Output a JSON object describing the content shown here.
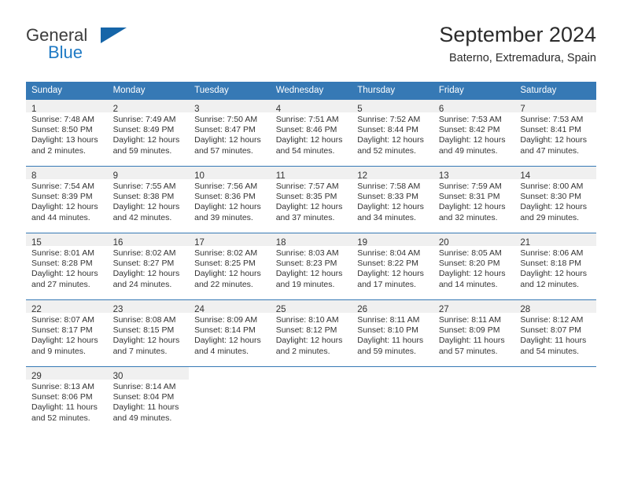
{
  "brand": {
    "name_part1": "General",
    "name_part2": "Blue",
    "logo_icon": "triangle-flag-icon"
  },
  "header": {
    "title": "September 2024",
    "subtitle": "Baterno, Extremadura, Spain"
  },
  "colors": {
    "header_blue": "#3679b5",
    "brand_blue": "#1f7ac4",
    "daynum_bg": "#f0f0f0",
    "text": "#333333"
  },
  "weekday_headers": [
    "Sunday",
    "Monday",
    "Tuesday",
    "Wednesday",
    "Thursday",
    "Friday",
    "Saturday"
  ],
  "weeks": [
    [
      {
        "day": "1",
        "sunrise": "Sunrise: 7:48 AM",
        "sunset": "Sunset: 8:50 PM",
        "daylight_line1": "Daylight: 13 hours",
        "daylight_line2": "and 2 minutes."
      },
      {
        "day": "2",
        "sunrise": "Sunrise: 7:49 AM",
        "sunset": "Sunset: 8:49 PM",
        "daylight_line1": "Daylight: 12 hours",
        "daylight_line2": "and 59 minutes."
      },
      {
        "day": "3",
        "sunrise": "Sunrise: 7:50 AM",
        "sunset": "Sunset: 8:47 PM",
        "daylight_line1": "Daylight: 12 hours",
        "daylight_line2": "and 57 minutes."
      },
      {
        "day": "4",
        "sunrise": "Sunrise: 7:51 AM",
        "sunset": "Sunset: 8:46 PM",
        "daylight_line1": "Daylight: 12 hours",
        "daylight_line2": "and 54 minutes."
      },
      {
        "day": "5",
        "sunrise": "Sunrise: 7:52 AM",
        "sunset": "Sunset: 8:44 PM",
        "daylight_line1": "Daylight: 12 hours",
        "daylight_line2": "and 52 minutes."
      },
      {
        "day": "6",
        "sunrise": "Sunrise: 7:53 AM",
        "sunset": "Sunset: 8:42 PM",
        "daylight_line1": "Daylight: 12 hours",
        "daylight_line2": "and 49 minutes."
      },
      {
        "day": "7",
        "sunrise": "Sunrise: 7:53 AM",
        "sunset": "Sunset: 8:41 PM",
        "daylight_line1": "Daylight: 12 hours",
        "daylight_line2": "and 47 minutes."
      }
    ],
    [
      {
        "day": "8",
        "sunrise": "Sunrise: 7:54 AM",
        "sunset": "Sunset: 8:39 PM",
        "daylight_line1": "Daylight: 12 hours",
        "daylight_line2": "and 44 minutes."
      },
      {
        "day": "9",
        "sunrise": "Sunrise: 7:55 AM",
        "sunset": "Sunset: 8:38 PM",
        "daylight_line1": "Daylight: 12 hours",
        "daylight_line2": "and 42 minutes."
      },
      {
        "day": "10",
        "sunrise": "Sunrise: 7:56 AM",
        "sunset": "Sunset: 8:36 PM",
        "daylight_line1": "Daylight: 12 hours",
        "daylight_line2": "and 39 minutes."
      },
      {
        "day": "11",
        "sunrise": "Sunrise: 7:57 AM",
        "sunset": "Sunset: 8:35 PM",
        "daylight_line1": "Daylight: 12 hours",
        "daylight_line2": "and 37 minutes."
      },
      {
        "day": "12",
        "sunrise": "Sunrise: 7:58 AM",
        "sunset": "Sunset: 8:33 PM",
        "daylight_line1": "Daylight: 12 hours",
        "daylight_line2": "and 34 minutes."
      },
      {
        "day": "13",
        "sunrise": "Sunrise: 7:59 AM",
        "sunset": "Sunset: 8:31 PM",
        "daylight_line1": "Daylight: 12 hours",
        "daylight_line2": "and 32 minutes."
      },
      {
        "day": "14",
        "sunrise": "Sunrise: 8:00 AM",
        "sunset": "Sunset: 8:30 PM",
        "daylight_line1": "Daylight: 12 hours",
        "daylight_line2": "and 29 minutes."
      }
    ],
    [
      {
        "day": "15",
        "sunrise": "Sunrise: 8:01 AM",
        "sunset": "Sunset: 8:28 PM",
        "daylight_line1": "Daylight: 12 hours",
        "daylight_line2": "and 27 minutes."
      },
      {
        "day": "16",
        "sunrise": "Sunrise: 8:02 AM",
        "sunset": "Sunset: 8:27 PM",
        "daylight_line1": "Daylight: 12 hours",
        "daylight_line2": "and 24 minutes."
      },
      {
        "day": "17",
        "sunrise": "Sunrise: 8:02 AM",
        "sunset": "Sunset: 8:25 PM",
        "daylight_line1": "Daylight: 12 hours",
        "daylight_line2": "and 22 minutes."
      },
      {
        "day": "18",
        "sunrise": "Sunrise: 8:03 AM",
        "sunset": "Sunset: 8:23 PM",
        "daylight_line1": "Daylight: 12 hours",
        "daylight_line2": "and 19 minutes."
      },
      {
        "day": "19",
        "sunrise": "Sunrise: 8:04 AM",
        "sunset": "Sunset: 8:22 PM",
        "daylight_line1": "Daylight: 12 hours",
        "daylight_line2": "and 17 minutes."
      },
      {
        "day": "20",
        "sunrise": "Sunrise: 8:05 AM",
        "sunset": "Sunset: 8:20 PM",
        "daylight_line1": "Daylight: 12 hours",
        "daylight_line2": "and 14 minutes."
      },
      {
        "day": "21",
        "sunrise": "Sunrise: 8:06 AM",
        "sunset": "Sunset: 8:18 PM",
        "daylight_line1": "Daylight: 12 hours",
        "daylight_line2": "and 12 minutes."
      }
    ],
    [
      {
        "day": "22",
        "sunrise": "Sunrise: 8:07 AM",
        "sunset": "Sunset: 8:17 PM",
        "daylight_line1": "Daylight: 12 hours",
        "daylight_line2": "and 9 minutes."
      },
      {
        "day": "23",
        "sunrise": "Sunrise: 8:08 AM",
        "sunset": "Sunset: 8:15 PM",
        "daylight_line1": "Daylight: 12 hours",
        "daylight_line2": "and 7 minutes."
      },
      {
        "day": "24",
        "sunrise": "Sunrise: 8:09 AM",
        "sunset": "Sunset: 8:14 PM",
        "daylight_line1": "Daylight: 12 hours",
        "daylight_line2": "and 4 minutes."
      },
      {
        "day": "25",
        "sunrise": "Sunrise: 8:10 AM",
        "sunset": "Sunset: 8:12 PM",
        "daylight_line1": "Daylight: 12 hours",
        "daylight_line2": "and 2 minutes."
      },
      {
        "day": "26",
        "sunrise": "Sunrise: 8:11 AM",
        "sunset": "Sunset: 8:10 PM",
        "daylight_line1": "Daylight: 11 hours",
        "daylight_line2": "and 59 minutes."
      },
      {
        "day": "27",
        "sunrise": "Sunrise: 8:11 AM",
        "sunset": "Sunset: 8:09 PM",
        "daylight_line1": "Daylight: 11 hours",
        "daylight_line2": "and 57 minutes."
      },
      {
        "day": "28",
        "sunrise": "Sunrise: 8:12 AM",
        "sunset": "Sunset: 8:07 PM",
        "daylight_line1": "Daylight: 11 hours",
        "daylight_line2": "and 54 minutes."
      }
    ],
    [
      {
        "day": "29",
        "sunrise": "Sunrise: 8:13 AM",
        "sunset": "Sunset: 8:06 PM",
        "daylight_line1": "Daylight: 11 hours",
        "daylight_line2": "and 52 minutes."
      },
      {
        "day": "30",
        "sunrise": "Sunrise: 8:14 AM",
        "sunset": "Sunset: 8:04 PM",
        "daylight_line1": "Daylight: 11 hours",
        "daylight_line2": "and 49 minutes."
      },
      {
        "day": "",
        "sunrise": "",
        "sunset": "",
        "daylight_line1": "",
        "daylight_line2": ""
      },
      {
        "day": "",
        "sunrise": "",
        "sunset": "",
        "daylight_line1": "",
        "daylight_line2": ""
      },
      {
        "day": "",
        "sunrise": "",
        "sunset": "",
        "daylight_line1": "",
        "daylight_line2": ""
      },
      {
        "day": "",
        "sunrise": "",
        "sunset": "",
        "daylight_line1": "",
        "daylight_line2": ""
      },
      {
        "day": "",
        "sunrise": "",
        "sunset": "",
        "daylight_line1": "",
        "daylight_line2": ""
      }
    ]
  ]
}
